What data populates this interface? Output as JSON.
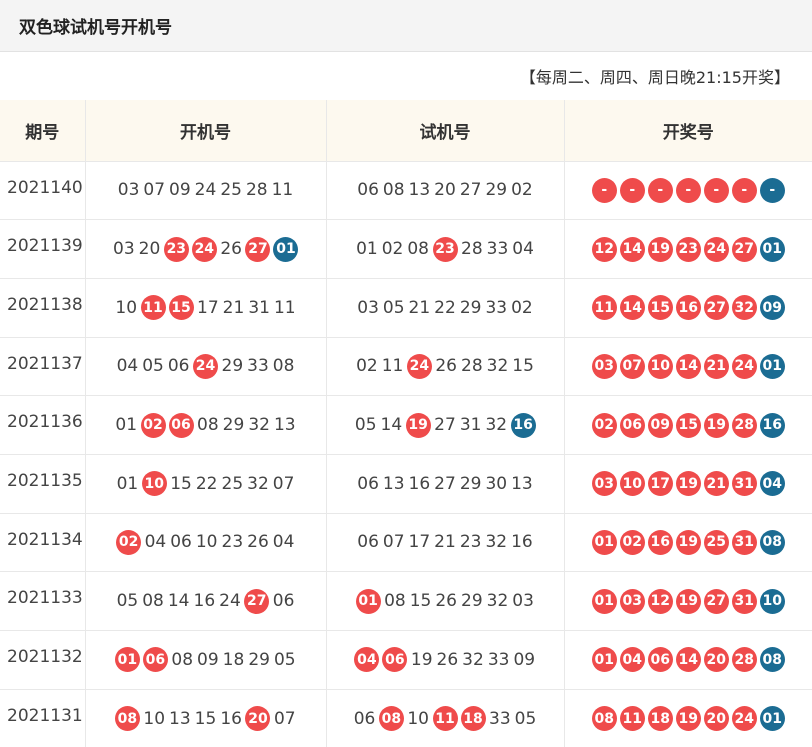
{
  "header": {
    "title": "双色球试机号开机号"
  },
  "schedule": "【每周二、周四、周日晚21:15开奖】",
  "columns": [
    "期号",
    "开机号",
    "试机号",
    "开奖号"
  ],
  "colors": {
    "red": "#ef4b4b",
    "blue": "#1b6c93"
  },
  "rows": [
    {
      "issue": "2021140",
      "kaiji": [
        {
          "n": "03",
          "h": 0
        },
        {
          "n": "07",
          "h": 0
        },
        {
          "n": "09",
          "h": 0
        },
        {
          "n": "24",
          "h": 0
        },
        {
          "n": "25",
          "h": 0
        },
        {
          "n": "28",
          "h": 0
        },
        {
          "n": "11",
          "h": 0
        }
      ],
      "shiji": [
        {
          "n": "06",
          "h": 0
        },
        {
          "n": "08",
          "h": 0
        },
        {
          "n": "13",
          "h": 0
        },
        {
          "n": "20",
          "h": 0
        },
        {
          "n": "27",
          "h": 0
        },
        {
          "n": "29",
          "h": 0
        },
        {
          "n": "02",
          "h": 0
        }
      ],
      "kaijiang": [
        "-",
        "-",
        "-",
        "-",
        "-",
        "-",
        "-"
      ]
    },
    {
      "issue": "2021139",
      "kaiji": [
        {
          "n": "03",
          "h": 0
        },
        {
          "n": "20",
          "h": 0
        },
        {
          "n": "23",
          "h": 1
        },
        {
          "n": "24",
          "h": 1
        },
        {
          "n": "26",
          "h": 0
        },
        {
          "n": "27",
          "h": 1
        },
        {
          "n": "01",
          "h": 2
        }
      ],
      "shiji": [
        {
          "n": "01",
          "h": 0
        },
        {
          "n": "02",
          "h": 0
        },
        {
          "n": "08",
          "h": 0
        },
        {
          "n": "23",
          "h": 1
        },
        {
          "n": "28",
          "h": 0
        },
        {
          "n": "33",
          "h": 0
        },
        {
          "n": "04",
          "h": 0
        }
      ],
      "kaijiang": [
        "12",
        "14",
        "19",
        "23",
        "24",
        "27",
        "01"
      ]
    },
    {
      "issue": "2021138",
      "kaiji": [
        {
          "n": "10",
          "h": 0
        },
        {
          "n": "11",
          "h": 1
        },
        {
          "n": "15",
          "h": 1
        },
        {
          "n": "17",
          "h": 0
        },
        {
          "n": "21",
          "h": 0
        },
        {
          "n": "31",
          "h": 0
        },
        {
          "n": "11",
          "h": 0
        }
      ],
      "shiji": [
        {
          "n": "03",
          "h": 0
        },
        {
          "n": "05",
          "h": 0
        },
        {
          "n": "21",
          "h": 0
        },
        {
          "n": "22",
          "h": 0
        },
        {
          "n": "29",
          "h": 0
        },
        {
          "n": "33",
          "h": 0
        },
        {
          "n": "02",
          "h": 0
        }
      ],
      "kaijiang": [
        "11",
        "14",
        "15",
        "16",
        "27",
        "32",
        "09"
      ]
    },
    {
      "issue": "2021137",
      "kaiji": [
        {
          "n": "04",
          "h": 0
        },
        {
          "n": "05",
          "h": 0
        },
        {
          "n": "06",
          "h": 0
        },
        {
          "n": "24",
          "h": 1
        },
        {
          "n": "29",
          "h": 0
        },
        {
          "n": "33",
          "h": 0
        },
        {
          "n": "08",
          "h": 0
        }
      ],
      "shiji": [
        {
          "n": "02",
          "h": 0
        },
        {
          "n": "11",
          "h": 0
        },
        {
          "n": "24",
          "h": 1
        },
        {
          "n": "26",
          "h": 0
        },
        {
          "n": "28",
          "h": 0
        },
        {
          "n": "32",
          "h": 0
        },
        {
          "n": "15",
          "h": 0
        }
      ],
      "kaijiang": [
        "03",
        "07",
        "10",
        "14",
        "21",
        "24",
        "01"
      ]
    },
    {
      "issue": "2021136",
      "kaiji": [
        {
          "n": "01",
          "h": 0
        },
        {
          "n": "02",
          "h": 1
        },
        {
          "n": "06",
          "h": 1
        },
        {
          "n": "08",
          "h": 0
        },
        {
          "n": "29",
          "h": 0
        },
        {
          "n": "32",
          "h": 0
        },
        {
          "n": "13",
          "h": 0
        }
      ],
      "shiji": [
        {
          "n": "05",
          "h": 0
        },
        {
          "n": "14",
          "h": 0
        },
        {
          "n": "19",
          "h": 1
        },
        {
          "n": "27",
          "h": 0
        },
        {
          "n": "31",
          "h": 0
        },
        {
          "n": "32",
          "h": 0
        },
        {
          "n": "16",
          "h": 2
        }
      ],
      "kaijiang": [
        "02",
        "06",
        "09",
        "15",
        "19",
        "28",
        "16"
      ]
    },
    {
      "issue": "2021135",
      "kaiji": [
        {
          "n": "01",
          "h": 0
        },
        {
          "n": "10",
          "h": 1
        },
        {
          "n": "15",
          "h": 0
        },
        {
          "n": "22",
          "h": 0
        },
        {
          "n": "25",
          "h": 0
        },
        {
          "n": "32",
          "h": 0
        },
        {
          "n": "07",
          "h": 0
        }
      ],
      "shiji": [
        {
          "n": "06",
          "h": 0
        },
        {
          "n": "13",
          "h": 0
        },
        {
          "n": "16",
          "h": 0
        },
        {
          "n": "27",
          "h": 0
        },
        {
          "n": "29",
          "h": 0
        },
        {
          "n": "30",
          "h": 0
        },
        {
          "n": "13",
          "h": 0
        }
      ],
      "kaijiang": [
        "03",
        "10",
        "17",
        "19",
        "21",
        "31",
        "04"
      ]
    },
    {
      "issue": "2021134",
      "kaiji": [
        {
          "n": "02",
          "h": 1
        },
        {
          "n": "04",
          "h": 0
        },
        {
          "n": "06",
          "h": 0
        },
        {
          "n": "10",
          "h": 0
        },
        {
          "n": "23",
          "h": 0
        },
        {
          "n": "26",
          "h": 0
        },
        {
          "n": "04",
          "h": 0
        }
      ],
      "shiji": [
        {
          "n": "06",
          "h": 0
        },
        {
          "n": "07",
          "h": 0
        },
        {
          "n": "17",
          "h": 0
        },
        {
          "n": "21",
          "h": 0
        },
        {
          "n": "23",
          "h": 0
        },
        {
          "n": "32",
          "h": 0
        },
        {
          "n": "16",
          "h": 0
        }
      ],
      "kaijiang": [
        "01",
        "02",
        "16",
        "19",
        "25",
        "31",
        "08"
      ]
    },
    {
      "issue": "2021133",
      "kaiji": [
        {
          "n": "05",
          "h": 0
        },
        {
          "n": "08",
          "h": 0
        },
        {
          "n": "14",
          "h": 0
        },
        {
          "n": "16",
          "h": 0
        },
        {
          "n": "24",
          "h": 0
        },
        {
          "n": "27",
          "h": 1
        },
        {
          "n": "06",
          "h": 0
        }
      ],
      "shiji": [
        {
          "n": "01",
          "h": 1
        },
        {
          "n": "08",
          "h": 0
        },
        {
          "n": "15",
          "h": 0
        },
        {
          "n": "26",
          "h": 0
        },
        {
          "n": "29",
          "h": 0
        },
        {
          "n": "32",
          "h": 0
        },
        {
          "n": "03",
          "h": 0
        }
      ],
      "kaijiang": [
        "01",
        "03",
        "12",
        "19",
        "27",
        "31",
        "10"
      ]
    },
    {
      "issue": "2021132",
      "kaiji": [
        {
          "n": "01",
          "h": 1
        },
        {
          "n": "06",
          "h": 1
        },
        {
          "n": "08",
          "h": 0
        },
        {
          "n": "09",
          "h": 0
        },
        {
          "n": "18",
          "h": 0
        },
        {
          "n": "29",
          "h": 0
        },
        {
          "n": "05",
          "h": 0
        }
      ],
      "shiji": [
        {
          "n": "04",
          "h": 1
        },
        {
          "n": "06",
          "h": 1
        },
        {
          "n": "19",
          "h": 0
        },
        {
          "n": "26",
          "h": 0
        },
        {
          "n": "32",
          "h": 0
        },
        {
          "n": "33",
          "h": 0
        },
        {
          "n": "09",
          "h": 0
        }
      ],
      "kaijiang": [
        "01",
        "04",
        "06",
        "14",
        "20",
        "28",
        "08"
      ]
    },
    {
      "issue": "2021131",
      "kaiji": [
        {
          "n": "08",
          "h": 1
        },
        {
          "n": "10",
          "h": 0
        },
        {
          "n": "13",
          "h": 0
        },
        {
          "n": "15",
          "h": 0
        },
        {
          "n": "16",
          "h": 0
        },
        {
          "n": "20",
          "h": 1
        },
        {
          "n": "07",
          "h": 0
        }
      ],
      "shiji": [
        {
          "n": "06",
          "h": 0
        },
        {
          "n": "08",
          "h": 1
        },
        {
          "n": "10",
          "h": 0
        },
        {
          "n": "11",
          "h": 1
        },
        {
          "n": "18",
          "h": 1
        },
        {
          "n": "33",
          "h": 0
        },
        {
          "n": "05",
          "h": 0
        }
      ],
      "kaijiang": [
        "08",
        "11",
        "18",
        "19",
        "20",
        "24",
        "01"
      ]
    }
  ]
}
